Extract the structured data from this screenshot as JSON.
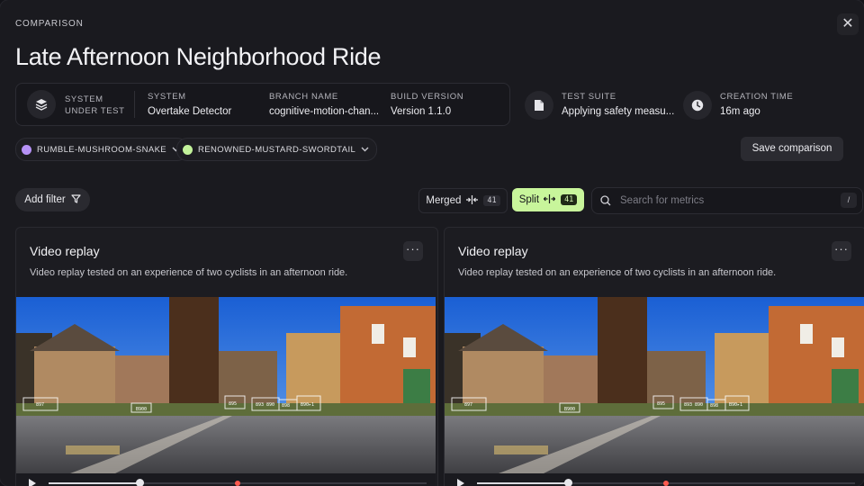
{
  "header": {
    "eyebrow": "COMPARISON",
    "title": "Late Afternoon Neighborhood Ride",
    "close_glyph": "✕"
  },
  "info": {
    "system_under_test_label_1": "SYSTEM",
    "system_under_test_label_2": "UNDER TEST",
    "system_label": "SYSTEM",
    "system_value": "Overtake Detector",
    "branch_label": "BRANCH NAME",
    "branch_value": "cognitive-motion-chan...",
    "build_label": "BUILD VERSION",
    "build_value": "Version 1.1.0",
    "suite_label": "TEST SUITE",
    "suite_value": "Applying safety measu...",
    "creation_label": "CREATION TIME",
    "creation_value": "16m ago"
  },
  "runs": [
    {
      "name": "RUMBLE-MUSHROOM-SNAKE",
      "color": "#b692f6"
    },
    {
      "name": "RENOWNED-MUSTARD-SWORDTAIL",
      "color": "#c2f29a"
    }
  ],
  "actions": {
    "save": "Save comparison",
    "add_filter": "Add filter"
  },
  "view_toggle": {
    "merged_label": "Merged",
    "merged_count": "41",
    "split_label": "Split",
    "split_count": "41",
    "active": "Split",
    "accent": "#c8f59b"
  },
  "search": {
    "placeholder": "Search for metrics",
    "shortcut": "/"
  },
  "cards": [
    {
      "title": "Video replay",
      "description": "Video replay tested on an experience of two cyclists in an afternoon ride.",
      "more": "···",
      "progress": 0.24,
      "marker": 0.5
    },
    {
      "title": "Video replay",
      "description": "Video replay tested on an experience of two cyclists in an afternoon ride.",
      "more": "···",
      "progress": 0.24,
      "marker": 0.5
    }
  ],
  "video_overlay_labels": [
    "897",
    "B900",
    "895",
    "893 890",
    "898",
    "B90▸1"
  ]
}
